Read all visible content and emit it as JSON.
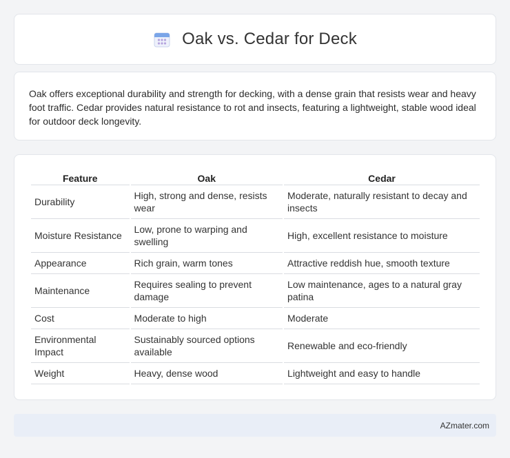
{
  "header": {
    "title": "Oak vs. Cedar for Deck",
    "icon": "calendar-icon"
  },
  "summary": {
    "text": "Oak offers exceptional durability and strength for decking, with a dense grain that resists wear and heavy foot traffic. Cedar provides natural resistance to rot and insects, featuring a lightweight, stable wood ideal for outdoor deck longevity."
  },
  "table": {
    "headers": [
      "Feature",
      "Oak",
      "Cedar"
    ],
    "rows": [
      [
        "Durability",
        "High, strong and dense, resists wear",
        "Moderate, naturally resistant to decay and insects"
      ],
      [
        "Moisture Resistance",
        "Low, prone to warping and swelling",
        "High, excellent resistance to moisture"
      ],
      [
        "Appearance",
        "Rich grain, warm tones",
        "Attractive reddish hue, smooth texture"
      ],
      [
        "Maintenance",
        "Requires sealing to prevent damage",
        "Low maintenance, ages to a natural gray patina"
      ],
      [
        "Cost",
        "Moderate to high",
        "Moderate"
      ],
      [
        "Environmental Impact",
        "Sustainably sourced options available",
        "Renewable and eco-friendly"
      ],
      [
        "Weight",
        "Heavy, dense wood",
        "Lightweight and easy to handle"
      ]
    ]
  },
  "footer": {
    "text": "AZmater.com"
  },
  "colors": {
    "background": "#f3f4f6",
    "card": "#ffffff",
    "footer": "#e9eef7",
    "icon_accent": "#7aa5e8"
  }
}
